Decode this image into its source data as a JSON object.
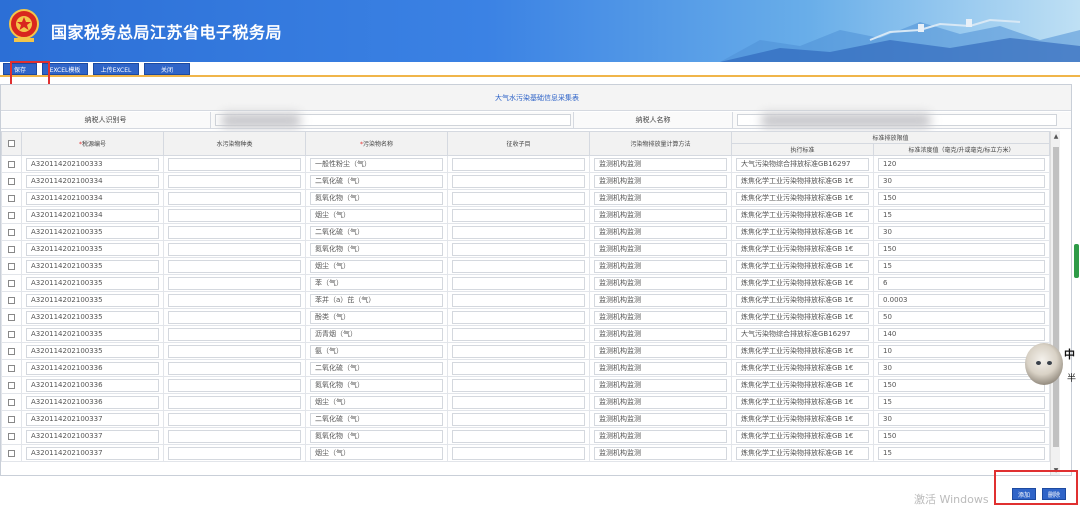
{
  "header": {
    "title": "国家税务总局江苏省电子税务局",
    "emblem": "tax-emblem-icon",
    "colors": {
      "banner_start": "#2c6fd6",
      "banner_end": "#bfe0f4",
      "button": "#2f64c8",
      "rule": "#f0b54a",
      "highlight": "#e03030"
    }
  },
  "toolbar": {
    "save_label": "保存",
    "template_label": "EXCEL模板",
    "upload_label": "上传EXCEL",
    "close_label": "关闭"
  },
  "form": {
    "title": "大气水污染基础信息采集表",
    "taxpayer_id_label": "纳税人识别号",
    "taxpayer_name_label": "纳税人名称"
  },
  "table": {
    "headers": {
      "tax_source_no": "*税源编号",
      "water_type": "水污染物种类",
      "pollutant_name": "*污染物名称",
      "tax_sub_item": "征收子目",
      "calc_method": "污染物排放量计算方法",
      "standard_group": "标准排放限值",
      "exec_standard": "执行标准",
      "concentration": "标准浓度值（毫克/升或毫克/标立方米）"
    },
    "rows": [
      {
        "source": "A320114202100333",
        "pollutant": "一般性粉尘（气）",
        "method": "监测机构监测",
        "standard": "大气污染物综合排放标准GB16297",
        "limit": "120"
      },
      {
        "source": "A320114202100334",
        "pollutant": "二氧化硫（气）",
        "method": "监测机构监测",
        "standard": "炼焦化学工业污染物排放标准GB 1€",
        "limit": "30"
      },
      {
        "source": "A320114202100334",
        "pollutant": "氮氧化物（气）",
        "method": "监测机构监测",
        "standard": "炼焦化学工业污染物排放标准GB 1€",
        "limit": "150"
      },
      {
        "source": "A320114202100334",
        "pollutant": "烟尘（气）",
        "method": "监测机构监测",
        "standard": "炼焦化学工业污染物排放标准GB 1€",
        "limit": "15"
      },
      {
        "source": "A320114202100335",
        "pollutant": "二氧化硫（气）",
        "method": "监测机构监测",
        "standard": "炼焦化学工业污染物排放标准GB 1€",
        "limit": "30"
      },
      {
        "source": "A320114202100335",
        "pollutant": "氮氧化物（气）",
        "method": "监测机构监测",
        "standard": "炼焦化学工业污染物排放标准GB 1€",
        "limit": "150"
      },
      {
        "source": "A320114202100335",
        "pollutant": "烟尘（气）",
        "method": "监测机构监测",
        "standard": "炼焦化学工业污染物排放标准GB 1€",
        "limit": "15"
      },
      {
        "source": "A320114202100335",
        "pollutant": "苯（气）",
        "method": "监测机构监测",
        "standard": "炼焦化学工业污染物排放标准GB 1€",
        "limit": "6"
      },
      {
        "source": "A320114202100335",
        "pollutant": "苯并（a）芘（气）",
        "method": "监测机构监测",
        "standard": "炼焦化学工业污染物排放标准GB 1€",
        "limit": "0.0003"
      },
      {
        "source": "A320114202100335",
        "pollutant": "酚类（气）",
        "method": "监测机构监测",
        "standard": "炼焦化学工业污染物排放标准GB 1€",
        "limit": "50"
      },
      {
        "source": "A320114202100335",
        "pollutant": "沥青烟（气）",
        "method": "监测机构监测",
        "standard": "大气污染物综合排放标准GB16297",
        "limit": "140"
      },
      {
        "source": "A320114202100335",
        "pollutant": "氨（气）",
        "method": "监测机构监测",
        "standard": "炼焦化学工业污染物排放标准GB 1€",
        "limit": "10"
      },
      {
        "source": "A320114202100336",
        "pollutant": "二氧化硫（气）",
        "method": "监测机构监测",
        "standard": "炼焦化学工业污染物排放标准GB 1€",
        "limit": "30"
      },
      {
        "source": "A320114202100336",
        "pollutant": "氮氧化物（气）",
        "method": "监测机构监测",
        "standard": "炼焦化学工业污染物排放标准GB 1€",
        "limit": "150"
      },
      {
        "source": "A320114202100336",
        "pollutant": "烟尘（气）",
        "method": "监测机构监测",
        "standard": "炼焦化学工业污染物排放标准GB 1€",
        "limit": "15"
      },
      {
        "source": "A320114202100337",
        "pollutant": "二氧化硫（气）",
        "method": "监测机构监测",
        "standard": "炼焦化学工业污染物排放标准GB 1€",
        "limit": "30"
      },
      {
        "source": "A320114202100337",
        "pollutant": "氮氧化物（气）",
        "method": "监测机构监测",
        "standard": "炼焦化学工业污染物排放标准GB 1€",
        "limit": "150"
      },
      {
        "source": "A320114202100337",
        "pollutant": "烟尘（气）",
        "method": "监测机构监测",
        "standard": "炼焦化学工业污染物排放标准GB 1€",
        "limit": "15"
      }
    ]
  },
  "footer": {
    "add_label": "添加",
    "delete_label": "删除",
    "watermark": "激活 Windows"
  },
  "ime": {
    "lang": "中",
    "mode": "半"
  }
}
